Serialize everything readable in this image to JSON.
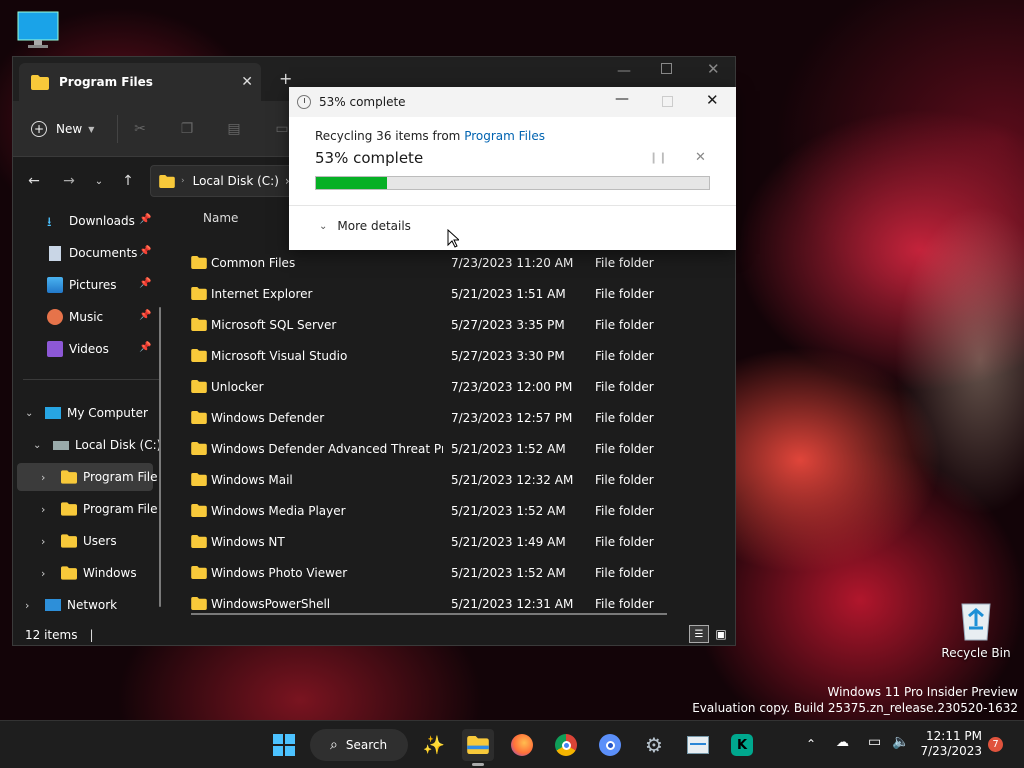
{
  "desktop": {
    "recycle_bin_label": "Recycle Bin",
    "watermark_line1": "Windows 11 Pro Insider Preview",
    "watermark_line2": "Evaluation copy. Build 25375.zn_release.230520-1632"
  },
  "explorer": {
    "tab_title": "Program Files",
    "new_tab_glyph": "+",
    "toolbar": {
      "new_label": "New"
    },
    "address": {
      "path_root": "Local Disk (C:)"
    },
    "sidebar": {
      "quick": [
        {
          "label": "Downloads"
        },
        {
          "label": "Documents"
        },
        {
          "label": "Pictures"
        },
        {
          "label": "Music"
        },
        {
          "label": "Videos"
        }
      ],
      "tree": [
        {
          "label": "My Computer"
        },
        {
          "label": "Local Disk (C:)"
        },
        {
          "label": "Program File"
        },
        {
          "label": "Program File"
        },
        {
          "label": "Users"
        },
        {
          "label": "Windows"
        },
        {
          "label": "Network"
        }
      ]
    },
    "columns": {
      "name": "Name"
    },
    "files": [
      {
        "name": "Common Files",
        "date": "7/23/2023 11:20 AM",
        "type": "File folder"
      },
      {
        "name": "Internet Explorer",
        "date": "5/21/2023 1:51 AM",
        "type": "File folder"
      },
      {
        "name": "Microsoft SQL Server",
        "date": "5/27/2023 3:35 PM",
        "type": "File folder"
      },
      {
        "name": "Microsoft Visual Studio",
        "date": "5/27/2023 3:30 PM",
        "type": "File folder"
      },
      {
        "name": "Unlocker",
        "date": "7/23/2023 12:00 PM",
        "type": "File folder"
      },
      {
        "name": "Windows Defender",
        "date": "7/23/2023 12:57 PM",
        "type": "File folder"
      },
      {
        "name": "Windows Defender Advanced Threat Prot...",
        "date": "5/21/2023 1:52 AM",
        "type": "File folder"
      },
      {
        "name": "Windows Mail",
        "date": "5/21/2023 12:32 AM",
        "type": "File folder"
      },
      {
        "name": "Windows Media Player",
        "date": "5/21/2023 1:52 AM",
        "type": "File folder"
      },
      {
        "name": "Windows NT",
        "date": "5/21/2023 1:49 AM",
        "type": "File folder"
      },
      {
        "name": "Windows Photo Viewer",
        "date": "5/21/2023 1:52 AM",
        "type": "File folder"
      },
      {
        "name": "WindowsPowerShell",
        "date": "5/21/2023 12:31 AM",
        "type": "File folder"
      }
    ],
    "status_count": "12 items"
  },
  "dialog": {
    "title": "53% complete",
    "recycling_prefix": "Recycling 36 items from ",
    "recycling_source": "Program Files",
    "heading": "53% complete",
    "progress": 0.18,
    "progress_color": "#06b025",
    "more_details": "More details"
  },
  "taskbar": {
    "search_label": "Search",
    "time": "12:11 PM",
    "date": "7/23/2023",
    "notification_count": "7",
    "icons": [
      "start-icon",
      "search-icon",
      "magic-wand-icon",
      "file-explorer-icon",
      "firefox-icon",
      "chrome-icon",
      "chromium-icon",
      "settings-icon",
      "resource-monitor-icon",
      "kaspersky-icon"
    ]
  }
}
